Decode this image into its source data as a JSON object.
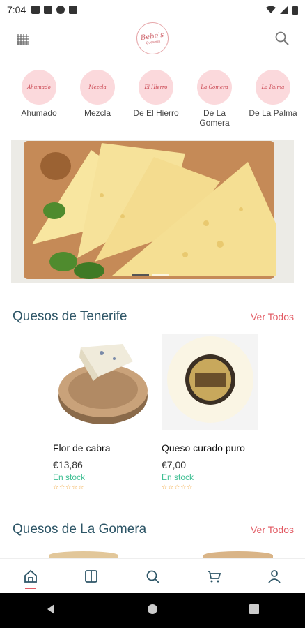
{
  "status_bar": {
    "time": "7:04"
  },
  "app": {
    "logo_text": "Bebe's",
    "logo_sub": "Quesería"
  },
  "categories": [
    {
      "badge": "Ahumado",
      "label": "Ahumado"
    },
    {
      "badge": "Mezcla",
      "label": "Mezcla"
    },
    {
      "badge": "El Hierro",
      "label": "De El Hierro"
    },
    {
      "badge": "La Gomera",
      "label": "De La Gomera"
    },
    {
      "badge": "La Palma",
      "label": "De La Palma"
    }
  ],
  "sections": [
    {
      "title": "Quesos de Tenerife",
      "see_all": "Ver Todos",
      "products": [
        {
          "name": "Flor de cabra",
          "price": "€13,86",
          "stock": "En stock",
          "stars": "☆☆☆☆☆"
        },
        {
          "name": "Queso curado puro",
          "price": "€7,00",
          "stock": "En stock",
          "stars": "☆☆☆☆☆"
        }
      ]
    },
    {
      "title": "Quesos de La Gomera",
      "see_all": "Ver Todos"
    }
  ],
  "colors": {
    "accent": "#e25a63",
    "title": "#2e5667",
    "stock": "#3fbf93",
    "category_bg": "#fbd9dc"
  },
  "bottom_nav": [
    "home-icon",
    "catalog-icon",
    "search-icon",
    "cart-icon",
    "profile-icon"
  ]
}
